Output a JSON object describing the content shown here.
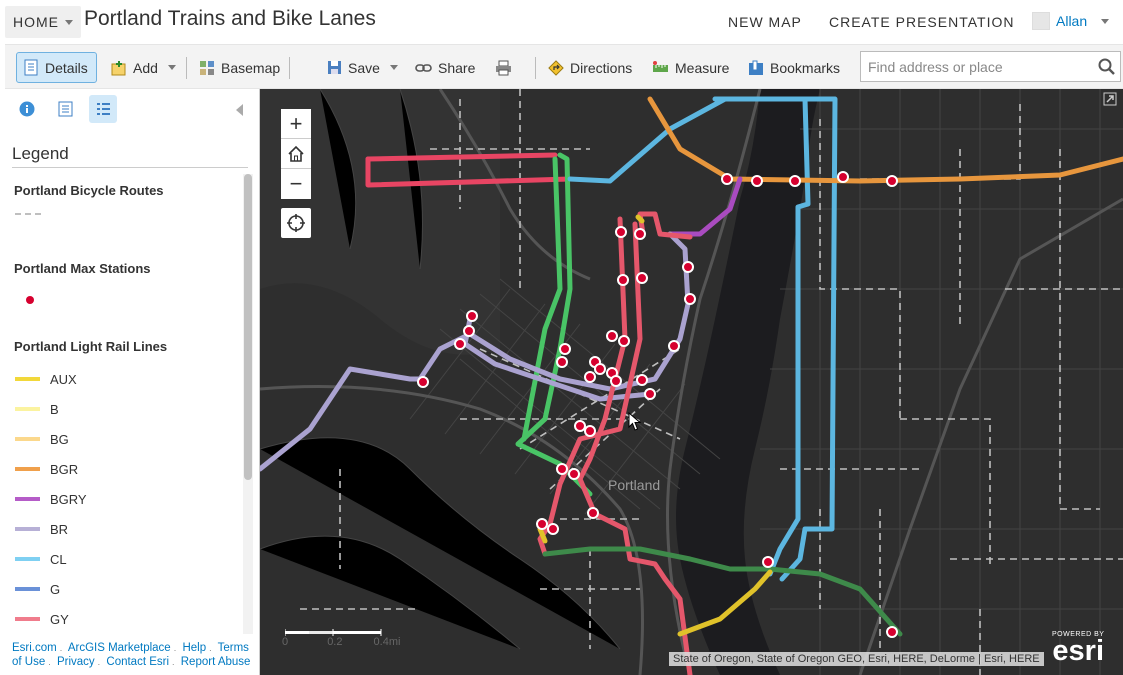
{
  "header": {
    "home_label": "HOME",
    "title": "Portland Trains and Bike Lanes",
    "new_map": "NEW MAP",
    "create_presentation": "CREATE PRESENTATION",
    "user_name": "Allan"
  },
  "toolbar": {
    "details": "Details",
    "add": "Add",
    "basemap": "Basemap",
    "save": "Save",
    "share": "Share",
    "directions": "Directions",
    "measure": "Measure",
    "bookmarks": "Bookmarks",
    "search_placeholder": "Find address or place"
  },
  "legend": {
    "title": "Legend",
    "bicycle_heading": "Portland Bicycle Routes",
    "stations_heading": "Portland Max Stations",
    "rail_heading": "Portland Light Rail Lines",
    "lines": [
      {
        "label": "AUX",
        "color": "#f2d83a"
      },
      {
        "label": "B",
        "color": "#fbf3a0"
      },
      {
        "label": "BG",
        "color": "#fbd88c"
      },
      {
        "label": "BGR",
        "color": "#f0a04b"
      },
      {
        "label": "BGRY",
        "color": "#b55cc8"
      },
      {
        "label": "BR",
        "color": "#b7b0d6"
      },
      {
        "label": "CL",
        "color": "#7fd0f2"
      },
      {
        "label": "G",
        "color": "#6a91d8"
      },
      {
        "label": "GY",
        "color": "#f07c8c"
      }
    ],
    "station_color": "#d6002f"
  },
  "footer": {
    "links": [
      "Esri.com",
      "ArcGIS Marketplace",
      "Help",
      "Terms of Use",
      "Privacy",
      "Contact Esri",
      "Report Abuse"
    ]
  },
  "map": {
    "city_label": "Portland",
    "scale_labels": [
      "0",
      "0.2",
      "0.4mi"
    ],
    "attribution": "State of Oregon, State of Oregon GEO, Esri, HERE, DeLorme | Esri, HERE",
    "esri_powered": "POWERED BY",
    "esri_word": "esri"
  }
}
